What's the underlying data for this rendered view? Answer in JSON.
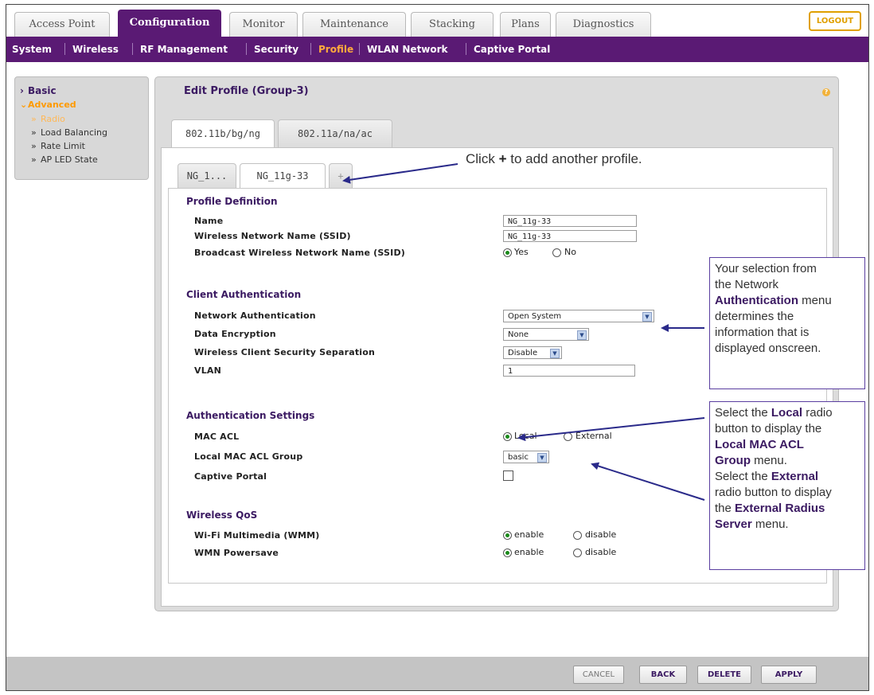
{
  "top_tabs": [
    "Access Point",
    "Configuration",
    "Monitor",
    "Maintenance",
    "Stacking",
    "Plans",
    "Diagnostics"
  ],
  "logout_label": "LOGOUT",
  "sub_nav": [
    "System",
    "Wireless",
    "RF Management",
    "Security",
    "Profile",
    "WLAN Network",
    "Captive Portal"
  ],
  "left_menu": {
    "basic": "Basic",
    "advanced": "Advanced",
    "radio": "Radio",
    "load_balancing": "Load Balancing",
    "rate_limit": "Rate Limit",
    "ap_led_state": "AP LED State"
  },
  "panel": {
    "title": "Edit Profile (Group-3)",
    "help": "?"
  },
  "band_tabs": [
    "802.11b/bg/ng",
    "802.11a/na/ac"
  ],
  "profile_tabs": [
    "NG_1...",
    "NG_11g-33",
    "+"
  ],
  "profile_definition": {
    "title": "Profile Definition",
    "name_label": "Name",
    "name_value": "NG_11g-33",
    "ssid_label": "Wireless Network Name (SSID)",
    "ssid_value": "NG_11g-33",
    "broadcast_label": "Broadcast Wireless Network Name (SSID)",
    "yes": "Yes",
    "no": "No"
  },
  "client_auth": {
    "title": "Client Authentication",
    "network_auth_label": "Network Authentication",
    "network_auth_value": "Open System",
    "data_enc_label": "Data Encryption",
    "data_enc_value": "None",
    "separation_label": "Wireless Client Security Separation",
    "separation_value": "Disable",
    "vlan_label": "VLAN",
    "vlan_value": "1"
  },
  "auth_settings": {
    "title": "Authentication Settings",
    "mac_acl_label": "MAC ACL",
    "local": "Local",
    "external": "External",
    "local_group_label": "Local MAC ACL Group",
    "local_group_value": "basic",
    "captive_label": "Captive Portal"
  },
  "qos": {
    "title": "Wireless QoS",
    "wmm_label": "Wi-Fi Multimedia (WMM)",
    "powersave_label": "WMN Powersave",
    "enable": "enable",
    "disable": "disable"
  },
  "footer_buttons": [
    "CANCEL",
    "BACK",
    "DELETE",
    "APPLY"
  ],
  "annotations": {
    "plus_note_pre": "Click",
    "plus_note_sym": "+",
    "plus_note_post": "to add another profile.",
    "auth_l1": "Your selection from",
    "auth_l2": "the Network",
    "auth_l3b": "Authentication",
    "auth_l3": "menu",
    "auth_l4": "determines the",
    "auth_l5": "information that is",
    "auth_l6": "displayed onscreen.",
    "mac_l1a": "Select the",
    "mac_l1b": "Local",
    "mac_l1c": "radio",
    "mac_l2": "button to display the",
    "mac_l3b": "Local MAC ACL",
    "mac_l4b": "Group",
    "mac_l4": "menu.",
    "mac_l5a": "Select the",
    "mac_l5b": "External",
    "mac_l6": "radio button to display",
    "mac_l7a": "the",
    "mac_l7b": "External Radius",
    "mac_l8b": "Server",
    "mac_l8": "menu."
  }
}
